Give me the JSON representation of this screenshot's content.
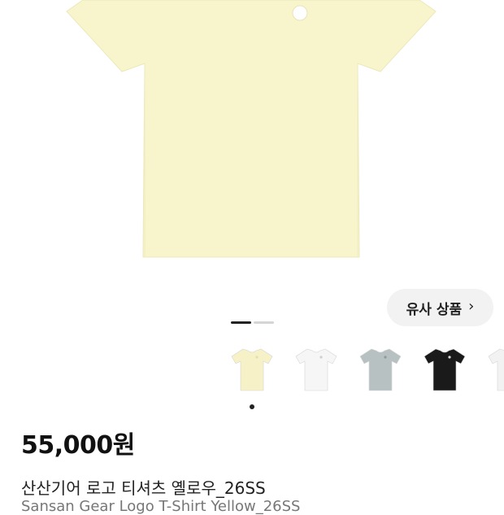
{
  "product": {
    "color_hex": "#f8f5cd",
    "similar_button_label": "유사 상품",
    "similar_button_icon": "chevron-right-icon",
    "image_index": 1,
    "image_count": 2,
    "price": "55,000원",
    "title": "산산기어 로고 티셔츠 옐로우_26SS",
    "subtitle": "Sansan Gear Logo T-Shirt Yellow_26SS"
  },
  "variants": [
    {
      "color": "#f6f1c7",
      "logo": "#e3dfb4"
    },
    {
      "color": "#f6f6f6",
      "logo": "#cfcfcf"
    },
    {
      "color": "#b8c1c2",
      "logo": "#8f9a9b"
    },
    {
      "color": "#1a1a1a",
      "logo": "#d9d9d9"
    },
    {
      "color": "#f2f2f2",
      "logo": "#cfcfcf"
    }
  ]
}
